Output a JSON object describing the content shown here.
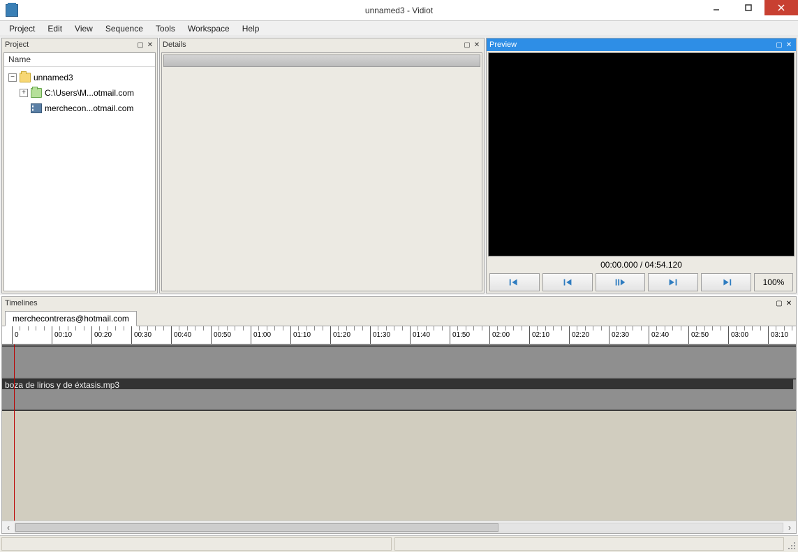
{
  "window": {
    "title": "unnamed3 - Vidiot"
  },
  "menu": {
    "items": [
      "Project",
      "Edit",
      "View",
      "Sequence",
      "Tools",
      "Workspace",
      "Help"
    ]
  },
  "panels": {
    "project": {
      "title": "Project",
      "column_header": "Name",
      "tree": {
        "root": "unnamed3",
        "child_folder": "C:\\Users\\M...otmail.com",
        "child_media": "merchecon...otmail.com"
      }
    },
    "details": {
      "title": "Details"
    },
    "preview": {
      "title": "Preview",
      "time": "00:00.000 / 04:54.120",
      "zoom": "100%"
    },
    "timelines": {
      "title": "Timelines",
      "tab": "merchecontreras@hotmail.com",
      "ruler_labels": [
        "0",
        "00:10",
        "00:20",
        "00:30",
        "00:40",
        "00:50",
        "01:00",
        "01:10",
        "01:20",
        "01:30",
        "01:40",
        "01:50",
        "02:00",
        "02:10",
        "02:20",
        "02:30",
        "02:40",
        "02:50",
        "03:00",
        "03:10"
      ],
      "clip_label": "boza   de lirios y de éxtasis.mp3"
    }
  }
}
